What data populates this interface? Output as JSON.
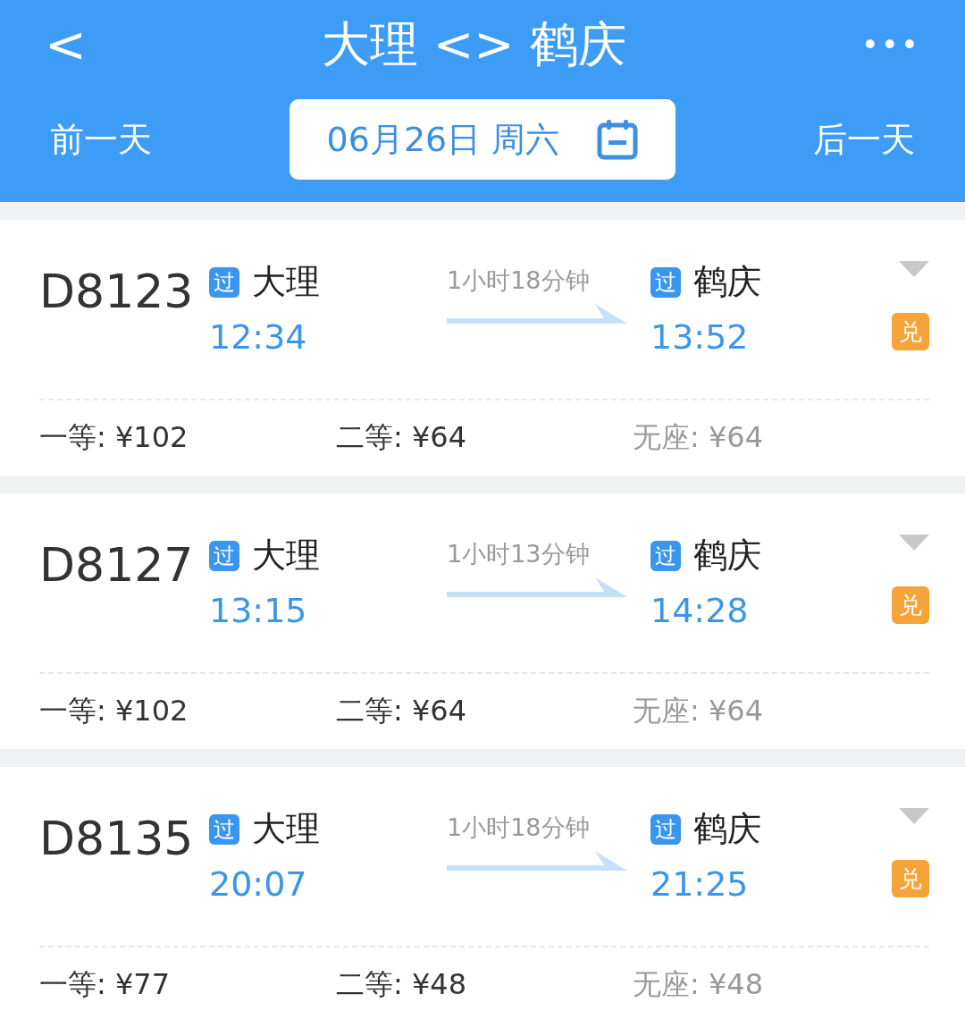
{
  "header": {
    "back": "<",
    "title": "大理 <> 鹤庆",
    "more": "•••",
    "prev_day": "前一天",
    "date": "06月26日 周六",
    "next_day": "后一天"
  },
  "trains": [
    {
      "number": "D8123",
      "from_badge": "过",
      "from": "大理",
      "depart": "12:34",
      "duration": "1小时18分钟",
      "to_badge": "过",
      "to": "鹤庆",
      "arrive": "13:52",
      "tag": "兑",
      "seats": [
        {
          "label": "一等:",
          "price": "¥102",
          "disabled": false
        },
        {
          "label": "二等:",
          "price": "¥64",
          "disabled": false
        },
        {
          "label": "无座:",
          "price": "¥64",
          "disabled": true
        }
      ]
    },
    {
      "number": "D8127",
      "from_badge": "过",
      "from": "大理",
      "depart": "13:15",
      "duration": "1小时13分钟",
      "to_badge": "过",
      "to": "鹤庆",
      "arrive": "14:28",
      "tag": "兑",
      "seats": [
        {
          "label": "一等:",
          "price": "¥102",
          "disabled": false
        },
        {
          "label": "二等:",
          "price": "¥64",
          "disabled": false
        },
        {
          "label": "无座:",
          "price": "¥64",
          "disabled": true
        }
      ]
    },
    {
      "number": "D8135",
      "from_badge": "过",
      "from": "大理",
      "depart": "20:07",
      "duration": "1小时18分钟",
      "to_badge": "过",
      "to": "鹤庆",
      "arrive": "21:25",
      "tag": "兑",
      "seats": [
        {
          "label": "一等:",
          "price": "¥77",
          "disabled": false
        },
        {
          "label": "二等:",
          "price": "¥48",
          "disabled": false
        },
        {
          "label": "无座:",
          "price": "¥48",
          "disabled": true
        }
      ]
    }
  ]
}
